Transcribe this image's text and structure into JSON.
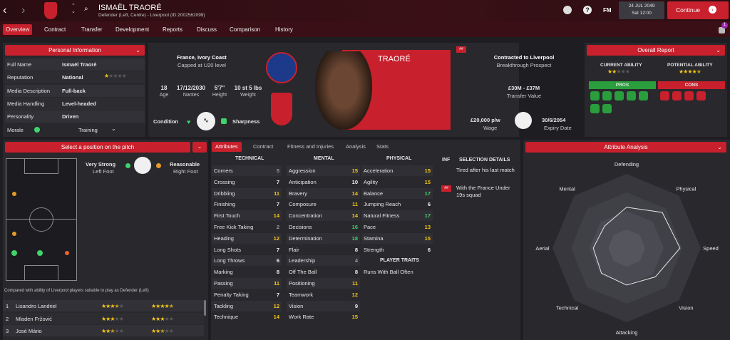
{
  "topbar": {
    "name": "ISMAËL TRAORÉ",
    "subtitle": "Defender (Left, Centre) - Liverpool (ID:2002562099)",
    "date": "24 JUL 2049",
    "time": "Sat 12:00",
    "continue": "Continue",
    "fm": "FM",
    "badge_count": "1"
  },
  "nav": [
    "Overview",
    "Contract",
    "Transfer",
    "Development",
    "Reports",
    "Discuss",
    "Comparison",
    "History"
  ],
  "personal": {
    "header": "Personal Information",
    "rows": [
      {
        "label": "Full Name",
        "value": "Ismaël Traoré"
      },
      {
        "label": "Reputation",
        "value": "National"
      },
      {
        "label": "Media Description",
        "value": "Full-back"
      },
      {
        "label": "Media Handling",
        "value": "Level-headed"
      },
      {
        "label": "Personality",
        "value": "Driven"
      }
    ],
    "morale_label": "Morale",
    "training_label": "Training"
  },
  "bio": {
    "nationality": "France, Ivory Coast",
    "caps": "Capped at U20 level",
    "age": "18",
    "age_l": "Age",
    "dob": "17/12/2030",
    "dob_l": "Nantes",
    "height": "5'7\"",
    "height_l": "Height",
    "weight": "10 st 5 lbs",
    "weight_l": "Weight",
    "condition": "Condition",
    "sharpness": "Sharpness",
    "surname": "TRAORÉ",
    "tag": "##"
  },
  "contract": {
    "title": "Contracted to Liverpool",
    "sub": "Breakthrough Prospect",
    "value": "£30M - £37M",
    "value_l": "Transfer Value",
    "wage": "£20,000 p/w",
    "wage_l": "Wage",
    "expiry": "30/6/2054",
    "expiry_l": "Expiry Date"
  },
  "overall": {
    "header": "Overall Report",
    "current": "CURRENT ABILITY",
    "potential": "POTENTIAL ABILITY",
    "current_stars": 2,
    "potential_stars": 4.5,
    "pros": "PROS",
    "cons": "CONS"
  },
  "position": {
    "header": "Select a position on the pitch",
    "foot1": "Very Strong",
    "foot1_sub": "Left Foot",
    "foot2": "Reasonable",
    "foot2_sub": "Right Foot",
    "compare": "Compared with ability of Liverpool players suitable to play as Defender (Left)",
    "players": [
      {
        "n": "1",
        "name": "Lisandro Landriel",
        "s1": 3.5,
        "s2": 4.5
      },
      {
        "n": "2",
        "name": "Mladen Fržović",
        "s1": 3,
        "s2": 3
      },
      {
        "n": "3",
        "name": "José Mário",
        "s1": 2.5,
        "s2": 2.5
      }
    ]
  },
  "tabs": [
    "Attributes",
    "Contract",
    "Fitness and Injuries",
    "Analysis",
    "Stats"
  ],
  "attributes": {
    "technical_h": "TECHNICAL",
    "mental_h": "MENTAL",
    "physical_h": "PHYSICAL",
    "technical": [
      [
        "Corners",
        "5"
      ],
      [
        "Crossing",
        "7"
      ],
      [
        "Dribbling",
        "11"
      ],
      [
        "Finishing",
        "7"
      ],
      [
        "First Touch",
        "14"
      ],
      [
        "Free Kick Taking",
        "2"
      ],
      [
        "Heading",
        "12"
      ],
      [
        "Long Shots",
        "7"
      ],
      [
        "Long Throws",
        "6"
      ],
      [
        "Marking",
        "8"
      ],
      [
        "Passing",
        "11"
      ],
      [
        "Penalty Taking",
        "7"
      ],
      [
        "Tackling",
        "12"
      ],
      [
        "Technique",
        "14"
      ]
    ],
    "mental": [
      [
        "Aggression",
        "15"
      ],
      [
        "Anticipation",
        "10"
      ],
      [
        "Bravery",
        "14"
      ],
      [
        "Composure",
        "11"
      ],
      [
        "Concentration",
        "14"
      ],
      [
        "Decisions",
        "16"
      ],
      [
        "Determination",
        "18"
      ],
      [
        "Flair",
        "8"
      ],
      [
        "Leadership",
        "4"
      ],
      [
        "Off The Ball",
        "8"
      ],
      [
        "Positioning",
        "11"
      ],
      [
        "Teamwork",
        "12"
      ],
      [
        "Vision",
        "9"
      ],
      [
        "Work Rate",
        "15"
      ]
    ],
    "physical": [
      [
        "Acceleration",
        "15"
      ],
      [
        "Agility",
        "15"
      ],
      [
        "Balance",
        "17"
      ],
      [
        "Jumping Reach",
        "6"
      ],
      [
        "Natural Fitness",
        "17"
      ],
      [
        "Pace",
        "13"
      ],
      [
        "Stamina",
        "15"
      ],
      [
        "Strength",
        "6"
      ]
    ],
    "traits_h": "PLAYER TRAITS",
    "trait": "Runs With Ball Often"
  },
  "selection": {
    "inf": "INF",
    "header": "SELECTION DETAILS",
    "line1": "Tired after his last match",
    "line2": "With the France Under 19s squad",
    "tag": "##"
  },
  "analysis": {
    "header": "Attribute Analysis",
    "labels": [
      "Defending",
      "Physical",
      "Speed",
      "Vision",
      "Attacking",
      "Technical",
      "Aerial",
      "Mental"
    ]
  },
  "colors": {
    "accent": "#c8202c",
    "green": "#3fd36a",
    "yellow": "#f5c518"
  }
}
